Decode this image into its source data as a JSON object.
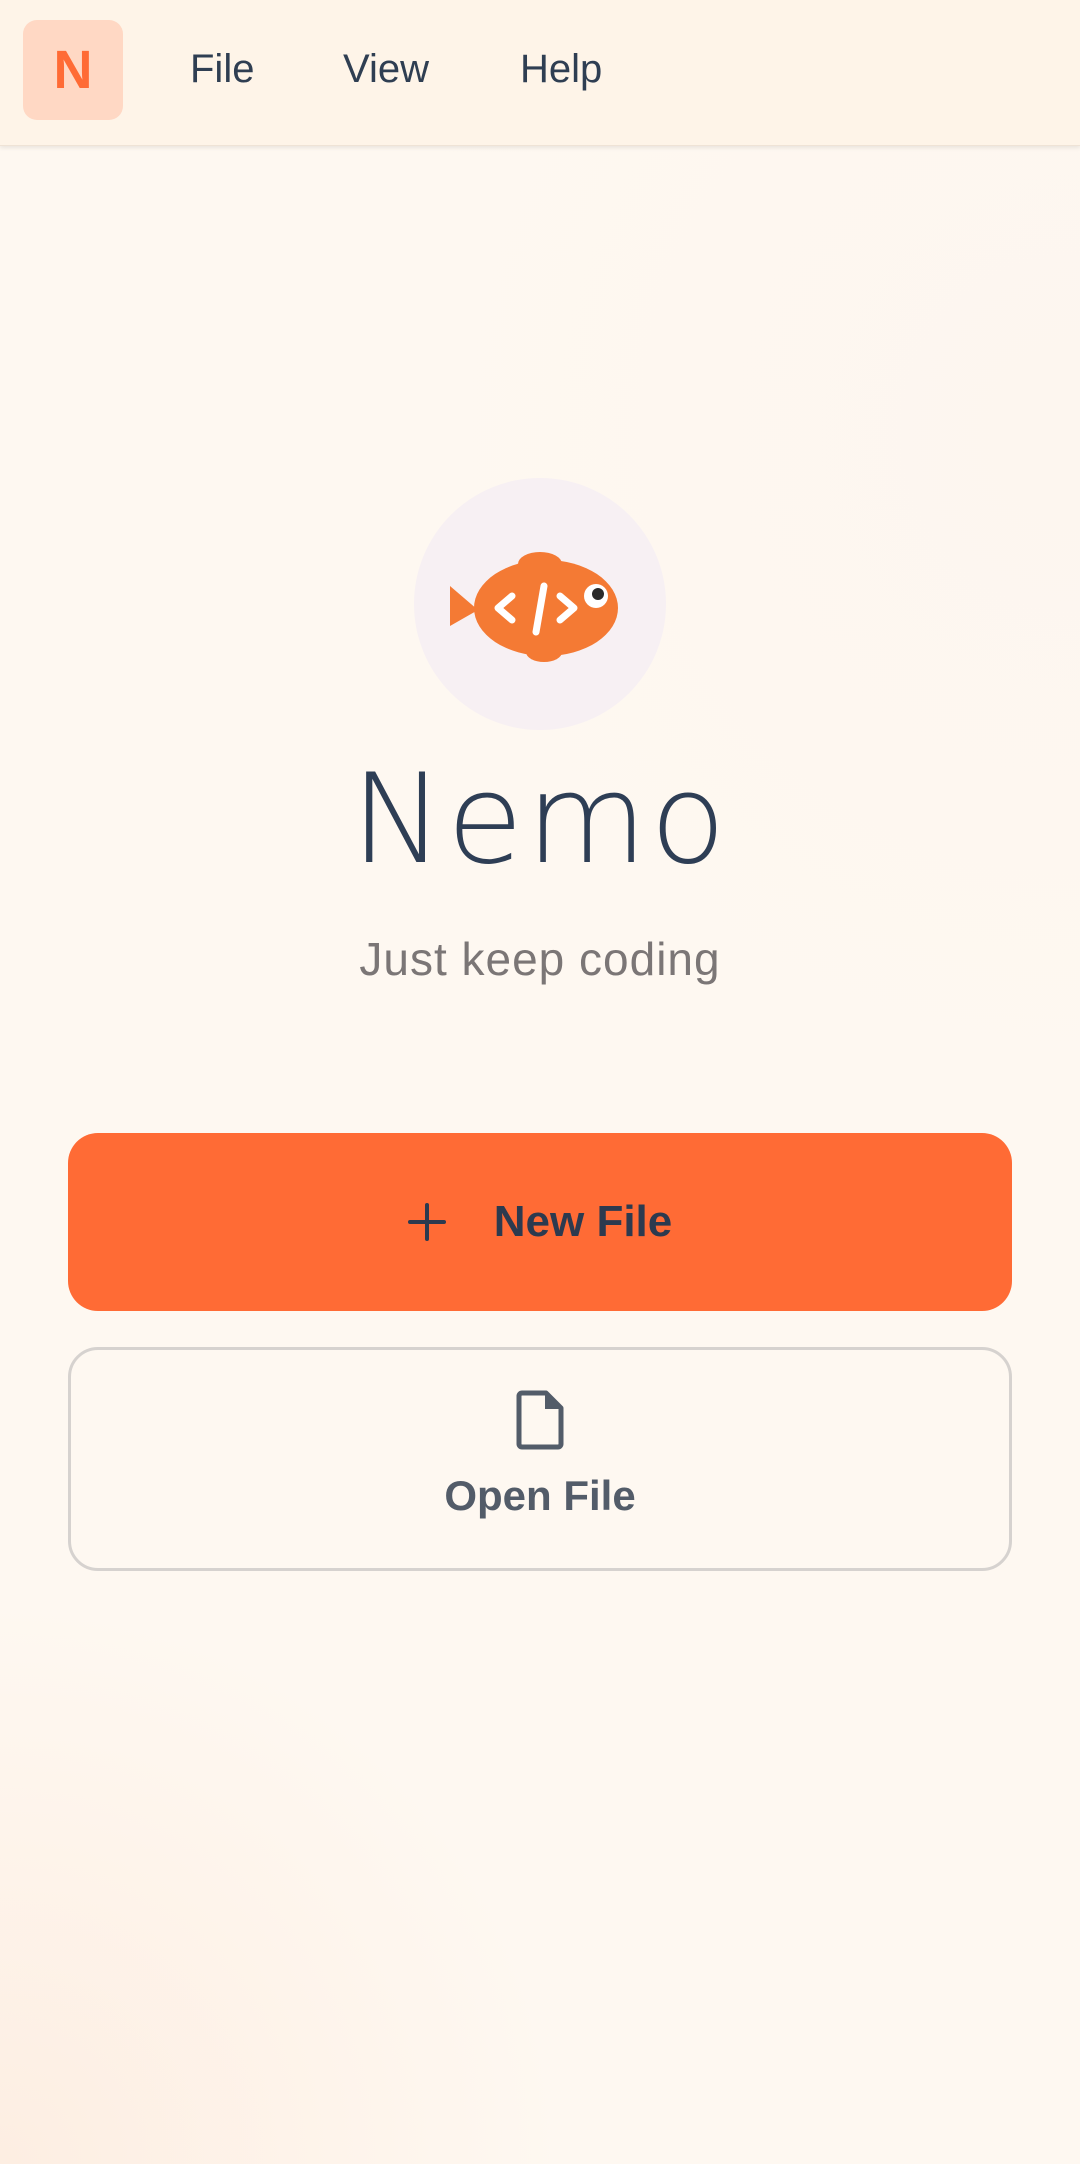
{
  "app": {
    "badge_letter": "N",
    "title": "Nemo",
    "tagline": "Just keep coding"
  },
  "menu": {
    "items": [
      {
        "label": "File"
      },
      {
        "label": "View"
      },
      {
        "label": "Help"
      }
    ]
  },
  "actions": {
    "new_file_label": "New File",
    "open_file_label": "Open File"
  },
  "icons": {
    "logo": "fish-code-icon",
    "new_file": "plus-icon",
    "open_file": "file-icon"
  },
  "colors": {
    "accent": "#ff6b35",
    "text_dark": "#2e3e55",
    "text_muted": "#7b7676",
    "menubar_bg": "#fef4e8",
    "badge_bg": "#ffd8c4",
    "logo_circle_bg": "#f7f0f3",
    "page_bg": "#fef8f1"
  }
}
